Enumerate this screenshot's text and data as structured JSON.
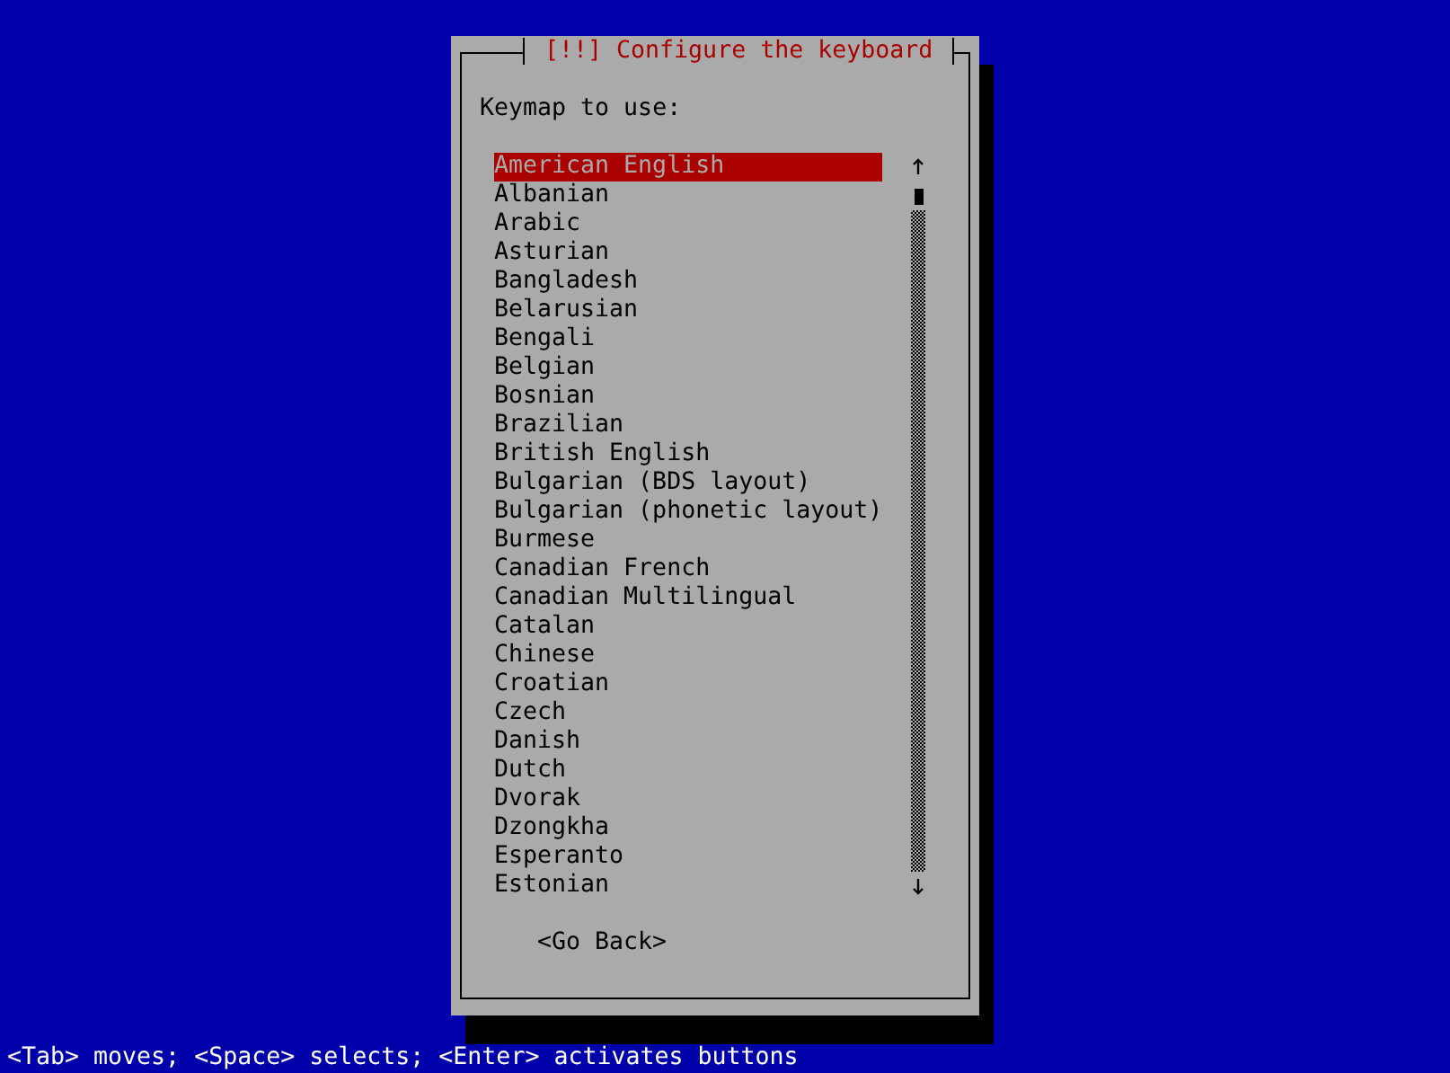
{
  "dialog": {
    "title": "[!!] Configure the keyboard",
    "prompt": "Keymap to use:",
    "keymaps": [
      {
        "label": "American English",
        "selected": true
      },
      {
        "label": "Albanian",
        "selected": false
      },
      {
        "label": "Arabic",
        "selected": false
      },
      {
        "label": "Asturian",
        "selected": false
      },
      {
        "label": "Bangladesh",
        "selected": false
      },
      {
        "label": "Belarusian",
        "selected": false
      },
      {
        "label": "Bengali",
        "selected": false
      },
      {
        "label": "Belgian",
        "selected": false
      },
      {
        "label": "Bosnian",
        "selected": false
      },
      {
        "label": "Brazilian",
        "selected": false
      },
      {
        "label": "British English",
        "selected": false
      },
      {
        "label": "Bulgarian (BDS layout)",
        "selected": false
      },
      {
        "label": "Bulgarian (phonetic layout)",
        "selected": false
      },
      {
        "label": "Burmese",
        "selected": false
      },
      {
        "label": "Canadian French",
        "selected": false
      },
      {
        "label": "Canadian Multilingual",
        "selected": false
      },
      {
        "label": "Catalan",
        "selected": false
      },
      {
        "label": "Chinese",
        "selected": false
      },
      {
        "label": "Croatian",
        "selected": false
      },
      {
        "label": "Czech",
        "selected": false
      },
      {
        "label": "Danish",
        "selected": false
      },
      {
        "label": "Dutch",
        "selected": false
      },
      {
        "label": "Dvorak",
        "selected": false
      },
      {
        "label": "Dzongkha",
        "selected": false
      },
      {
        "label": "Esperanto",
        "selected": false
      },
      {
        "label": "Estonian",
        "selected": false
      }
    ],
    "button": "<Go Back>"
  },
  "status_bar": "<Tab> moves; <Space> selects; <Enter> activates buttons"
}
